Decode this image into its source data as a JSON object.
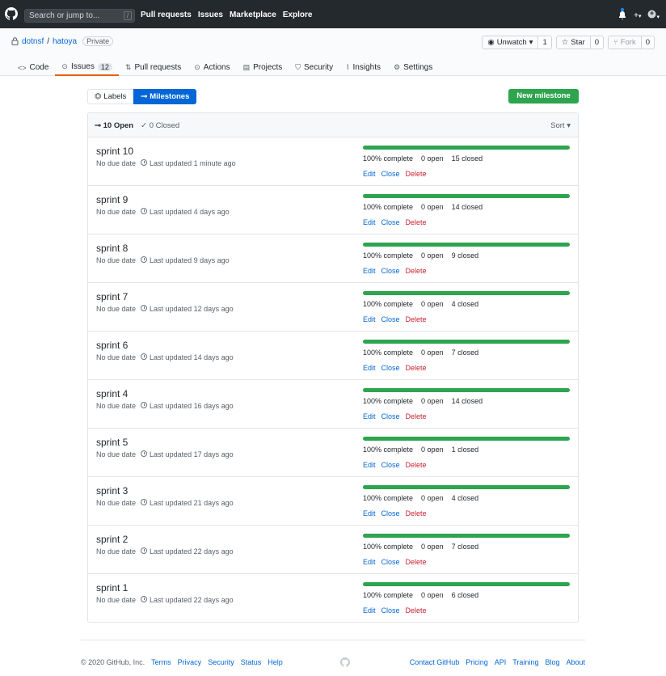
{
  "header": {
    "search_placeholder": "Search or jump to...",
    "search_key": "/",
    "nav": [
      "Pull requests",
      "Issues",
      "Marketplace",
      "Explore"
    ]
  },
  "repo": {
    "owner": "dotnsf",
    "separator": "/",
    "name": "hatoya",
    "visibility": "Private",
    "watch": {
      "label": "Unwatch",
      "count": "1"
    },
    "star": {
      "label": "Star",
      "count": "0"
    },
    "fork": {
      "label": "Fork",
      "count": "0"
    },
    "tabs": [
      {
        "label": "Code",
        "icon": "code-icon"
      },
      {
        "label": "Issues",
        "icon": "issue-icon",
        "counter": "12"
      },
      {
        "label": "Pull requests",
        "icon": "pull-request-icon"
      },
      {
        "label": "Actions",
        "icon": "play-icon"
      },
      {
        "label": "Projects",
        "icon": "project-icon"
      },
      {
        "label": "Security",
        "icon": "shield-icon"
      },
      {
        "label": "Insights",
        "icon": "graph-icon"
      },
      {
        "label": "Settings",
        "icon": "gear-icon"
      }
    ]
  },
  "toolbar": {
    "labels": "Labels",
    "milestones": "Milestones",
    "new_milestone": "New milestone"
  },
  "list": {
    "open": "10 Open",
    "closed": "0 Closed",
    "sort": "Sort",
    "milestones": [
      {
        "title": "sprint 10",
        "due": "No due date",
        "updated": "Last updated 1 minute ago",
        "percent": "100% complete",
        "progress": 1.0,
        "open": "0 open",
        "closed": "15 closed"
      },
      {
        "title": "sprint 9",
        "due": "No due date",
        "updated": "Last updated 4 days ago",
        "percent": "100% complete",
        "progress": 1.0,
        "open": "0 open",
        "closed": "14 closed"
      },
      {
        "title": "sprint 8",
        "due": "No due date",
        "updated": "Last updated 9 days ago",
        "percent": "100% complete",
        "progress": 1.0,
        "open": "0 open",
        "closed": "9 closed"
      },
      {
        "title": "sprint 7",
        "due": "No due date",
        "updated": "Last updated 12 days ago",
        "percent": "100% complete",
        "progress": 1.0,
        "open": "0 open",
        "closed": "4 closed"
      },
      {
        "title": "sprint 6",
        "due": "No due date",
        "updated": "Last updated 14 days ago",
        "percent": "100% complete",
        "progress": 1.0,
        "open": "0 open",
        "closed": "7 closed"
      },
      {
        "title": "sprint 4",
        "due": "No due date",
        "updated": "Last updated 16 days ago",
        "percent": "100% complete",
        "progress": 1.0,
        "open": "0 open",
        "closed": "14 closed"
      },
      {
        "title": "sprint 5",
        "due": "No due date",
        "updated": "Last updated 17 days ago",
        "percent": "100% complete",
        "progress": 1.0,
        "open": "0 open",
        "closed": "1 closed"
      },
      {
        "title": "sprint 3",
        "due": "No due date",
        "updated": "Last updated 21 days ago",
        "percent": "100% complete",
        "progress": 1.0,
        "open": "0 open",
        "closed": "4 closed"
      },
      {
        "title": "sprint 2",
        "due": "No due date",
        "updated": "Last updated 22 days ago",
        "percent": "100% complete",
        "progress": 1.0,
        "open": "0 open",
        "closed": "7 closed"
      },
      {
        "title": "sprint 1",
        "due": "No due date",
        "updated": "Last updated 22 days ago",
        "percent": "100% complete",
        "progress": 1.0,
        "open": "0 open",
        "closed": "6 closed"
      }
    ],
    "action_labels": {
      "edit": "Edit",
      "close": "Close",
      "delete": "Delete"
    }
  },
  "footer": {
    "copyright": "© 2020 GitHub, Inc.",
    "left_links": [
      "Terms",
      "Privacy",
      "Security",
      "Status",
      "Help"
    ],
    "right_links": [
      "Contact GitHub",
      "Pricing",
      "API",
      "Training",
      "Blog",
      "About"
    ]
  },
  "colors": {
    "header_bg": "#24292e",
    "progress": "#2ea44f",
    "link": "#0366d6",
    "delete": "#cb2431",
    "selected_tab": "#e36209"
  }
}
